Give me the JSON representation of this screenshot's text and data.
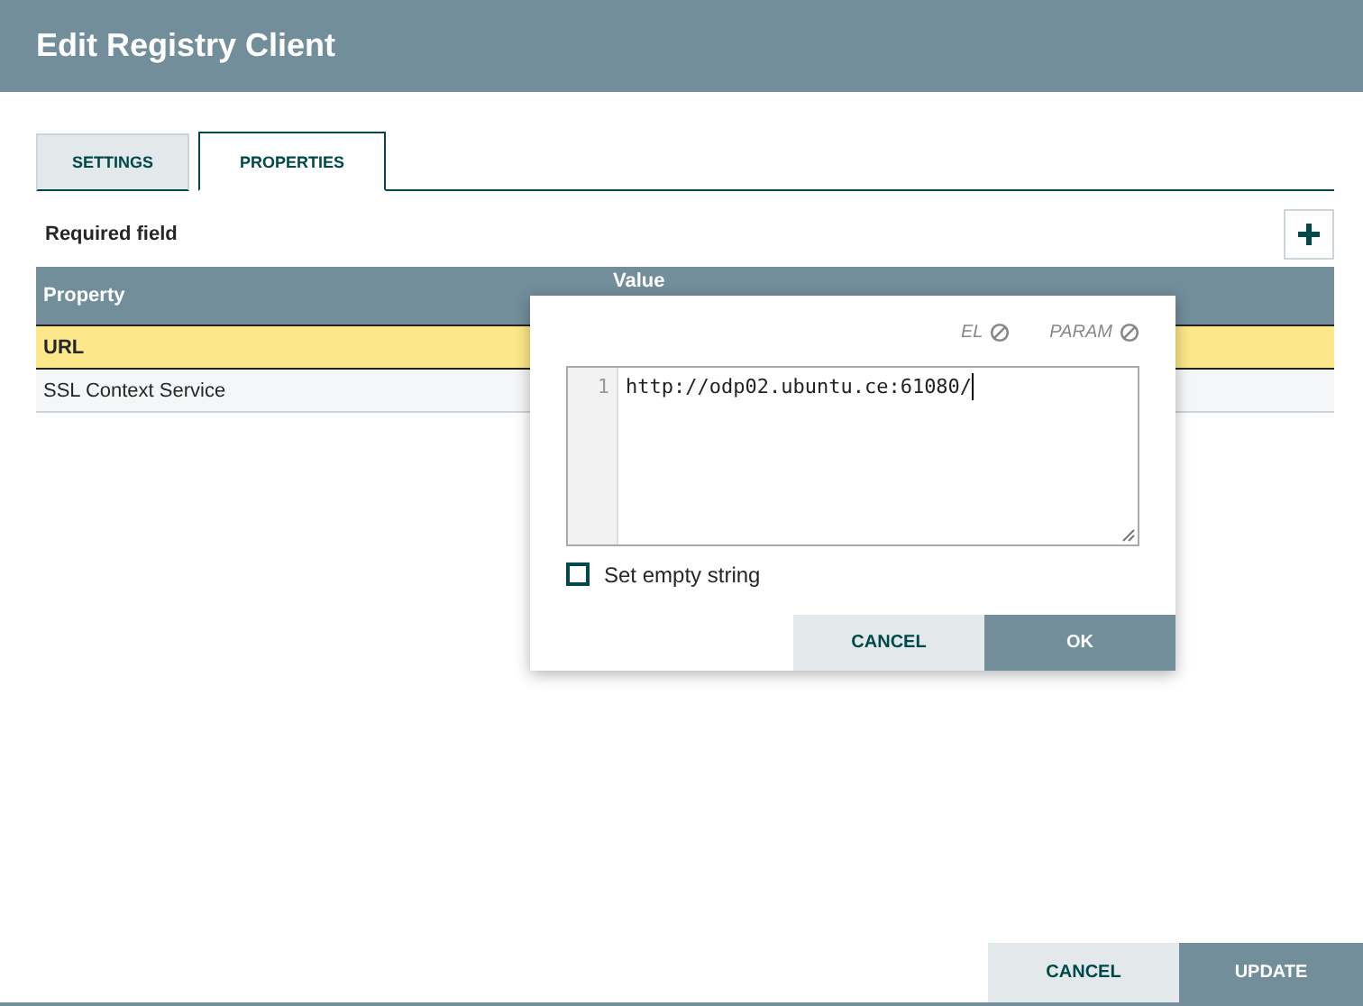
{
  "dialog": {
    "title": "Edit Registry Client"
  },
  "tabs": [
    {
      "label": "SETTINGS",
      "selected": false
    },
    {
      "label": "PROPERTIES",
      "selected": true
    }
  ],
  "required_note": "Required field",
  "table": {
    "columns": [
      "Property",
      "Value"
    ],
    "rows": [
      {
        "property": "URL",
        "required": true,
        "selected": true
      },
      {
        "property": "SSL Context Service",
        "required": false,
        "selected": false
      }
    ]
  },
  "editor": {
    "flags": [
      "EL",
      "PARAM"
    ],
    "line_number": "1",
    "value": "http://odp02.ubuntu.ce:61080/",
    "empty_string": {
      "label": "Set empty string",
      "checked": false
    },
    "buttons": [
      "CANCEL",
      "OK"
    ]
  },
  "footer_buttons": [
    "CANCEL",
    "UPDATE"
  ]
}
